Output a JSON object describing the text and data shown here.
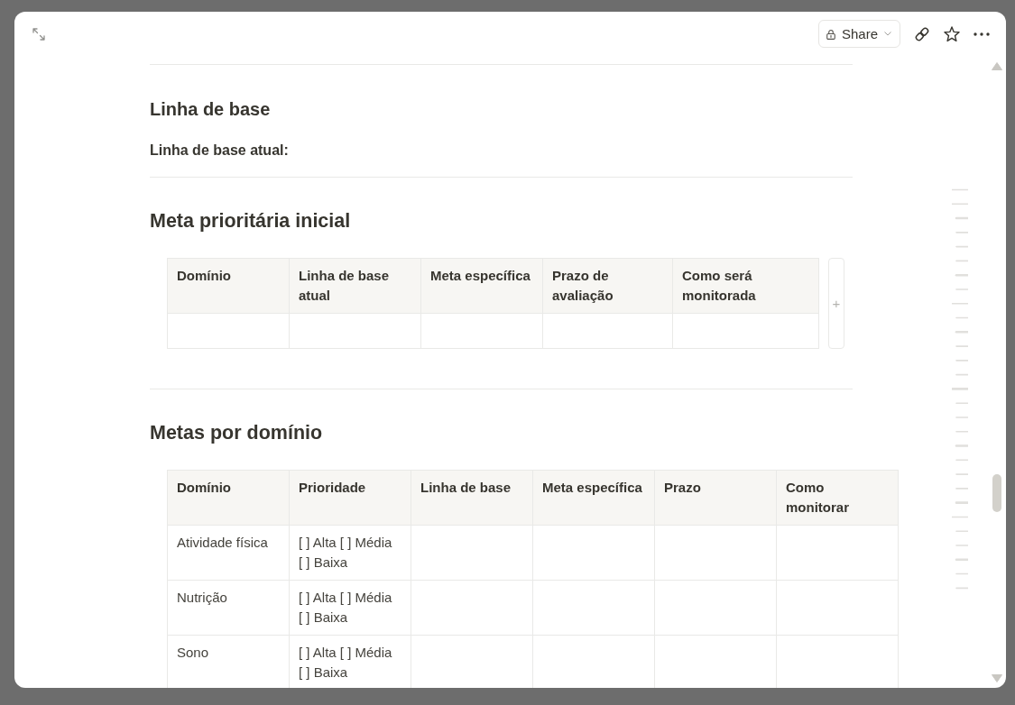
{
  "toolbar": {
    "share_button": {
      "label": "Share"
    }
  },
  "blocks": [
    {
      "kind": "divider"
    },
    {
      "kind": "heading_3",
      "text": "Linha de base"
    },
    {
      "kind": "bold_text",
      "text": "Linha de base atual:"
    },
    {
      "kind": "divider"
    },
    {
      "kind": "heading_2",
      "text": "Meta prioritária inicial"
    },
    {
      "kind": "table",
      "columns": [
        "Domínio",
        "Linha de base atual",
        "Meta específica",
        "Prazo de avaliação",
        "Como será monitorada"
      ],
      "rows": [
        {
          "kind": "empty"
        }
      ],
      "add_column_button": {
        "label": "+"
      }
    },
    {
      "kind": "divider"
    },
    {
      "kind": "heading_2",
      "text": "Metas por domínio"
    },
    {
      "kind": "table",
      "columns": [
        "Domínio",
        "Prioridade",
        "Linha de base",
        "Meta específica",
        "Prazo",
        "Como monitorar"
      ],
      "rows": [
        {
          "kind": "filled",
          "cells": [
            "Atividade física",
            "[ ] Alta [ ] Média [ ] Baixa"
          ]
        },
        {
          "kind": "filled",
          "cells": [
            "Nutrição",
            "[ ] Alta [ ] Média [ ] Baixa"
          ]
        },
        {
          "kind": "filled",
          "cells": [
            "Sono",
            "[ ] Alta [ ] Média [ ] Baixa"
          ]
        }
      ]
    }
  ]
}
